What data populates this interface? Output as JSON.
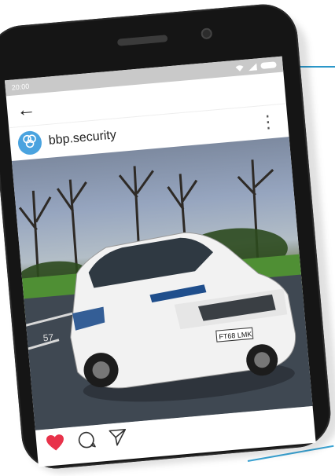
{
  "status_bar": {
    "time": "20:00",
    "icons": [
      "wifi-icon",
      "signal-icon",
      "battery-icon"
    ]
  },
  "nav": {
    "back_icon": "back-arrow-icon"
  },
  "post": {
    "username": "bbp.security",
    "avatar_icon": "bbp-logo-icon",
    "menu_icon": "more-vertical-icon",
    "photo": {
      "plate": "FT68 LMK",
      "bay_marking": "57"
    },
    "actions": [
      "heart-icon",
      "comment-icon",
      "share-icon"
    ]
  },
  "colors": {
    "accent": "#2b97c9",
    "like": "#e8324a",
    "phone_body": "#151515",
    "status_bar": "#c9c9c9",
    "avatar": "#4aa3df"
  }
}
